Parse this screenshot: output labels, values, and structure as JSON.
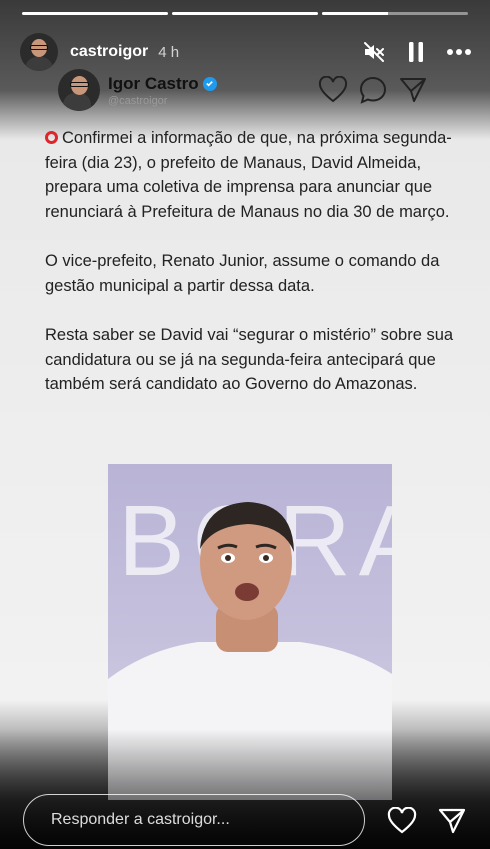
{
  "story": {
    "progress": [
      1,
      1,
      0.45
    ],
    "username": "castroigor",
    "time_ago": "4 h",
    "icons": {
      "mute": "mute-icon",
      "pause": "pause-icon",
      "more": "more-icon"
    }
  },
  "tweet": {
    "name": "Igor Castro",
    "handle": "@castroigor",
    "verified_color": "#1d9bf0",
    "paragraphs": [
      "Confirmei a informação de que, na próxima segunda-feira (dia 23), o prefeito de Manaus, David Almeida, prepara uma coletiva de imprensa para anunciar que renunciará à Prefeitura de Manaus no dia 30 de março.",
      "O vice-prefeito, Renato Junior, assume o comando da gestão municipal a partir dessa data.",
      "Resta saber se David vai “segurar o mistério” sobre sua candidatura ou se já na segunda-feira antecipará que também será candidato ao Governo do Amazonas."
    ],
    "image_word": "BORA"
  },
  "reply": {
    "placeholder": "Responder a castroigor..."
  }
}
